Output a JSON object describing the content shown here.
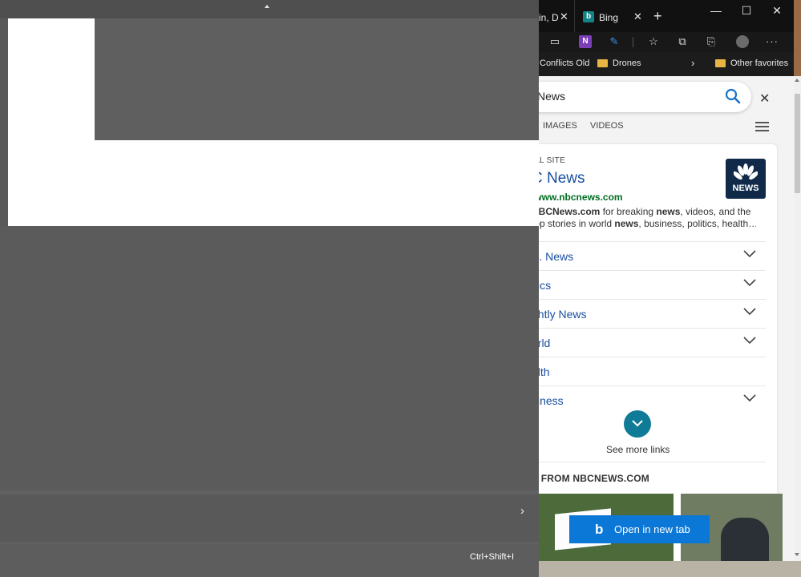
{
  "overlay": {
    "shortcut": "Ctrl+Shift+I"
  },
  "browser": {
    "tabs": [
      {
        "label": "in, D",
        "close": "✕"
      },
      {
        "label": "Bing",
        "icon": "bing-icon",
        "close": "✕"
      }
    ],
    "new_tab": "+",
    "window_controls": {
      "minimize": "—",
      "maximize": "☐",
      "close": "✕"
    },
    "toolbar_icons": [
      "extension-icon",
      "onenote-icon",
      "pen-icon",
      "favorites-icon",
      "collections-icon",
      "share-icon",
      "profile-avatar",
      "more-icon"
    ],
    "favorites": [
      {
        "label": "Conflicts Old"
      },
      {
        "label": "Drones",
        "icon": "folder-icon"
      },
      {
        "label": "Other favorites",
        "icon": "folder-icon"
      }
    ],
    "more_favorites": "›"
  },
  "search": {
    "query": "News",
    "tabs": [
      "IMAGES",
      "VIDEOS"
    ]
  },
  "result": {
    "official_label": "IAL SITE",
    "title": "C News",
    "url": "/www.nbcnews.com",
    "desc_line1": [
      "NBCNews.com",
      " for breaking ",
      "news",
      ", videos, and the"
    ],
    "desc_line2": [
      "top stories in world ",
      "news",
      ", business, politics, health…"
    ],
    "logo_text": "NEWS",
    "links": [
      {
        "label": "S. News",
        "expandable": true
      },
      {
        "label": "itics",
        "expandable": true
      },
      {
        "label": "ghtly News",
        "expandable": true
      },
      {
        "label": "orld",
        "expandable": true
      },
      {
        "label": "alth",
        "expandable": false
      },
      {
        "label": "siness",
        "expandable": true
      }
    ],
    "see_more": "See more links",
    "stories_heading": "S FROM NBCNEWS.COM"
  },
  "open_new_tab": "Open in new tab",
  "colors": {
    "accent": "#0b78d7",
    "link": "#1a4fa0",
    "url_green": "#006d21",
    "teal_button": "#0f7b96",
    "nbc_logo_bg": "#112a4a"
  }
}
